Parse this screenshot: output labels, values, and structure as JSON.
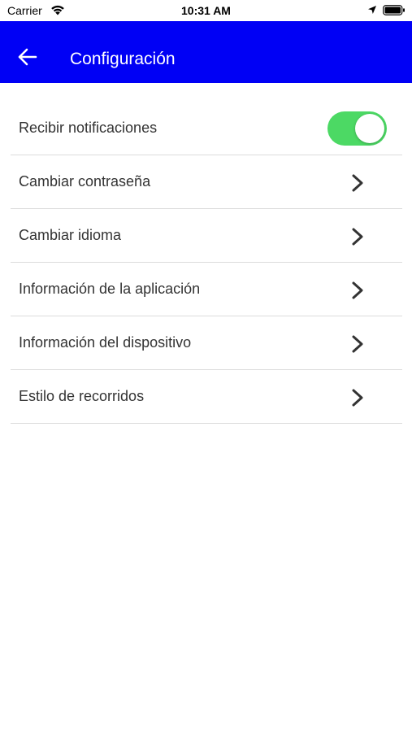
{
  "status_bar": {
    "carrier": "Carrier",
    "time": "10:31 AM",
    "wifi_icon": "wifi-icon",
    "location_icon": "location-arrow-icon",
    "battery_icon": "battery-full-icon"
  },
  "app_bar": {
    "title": "Configuración",
    "back_icon": "arrow-left-icon",
    "background_color": "#0000f5"
  },
  "settings": {
    "notifications": {
      "label": "Recibir notificaciones",
      "enabled": true,
      "toggle_color": "#4cd964"
    },
    "items": [
      {
        "label": "Cambiar contraseña",
        "icon": "chevron-right-icon"
      },
      {
        "label": "Cambiar idioma",
        "icon": "chevron-right-icon"
      },
      {
        "label": "Información de la aplicación",
        "icon": "chevron-right-icon"
      },
      {
        "label": "Información del dispositivo",
        "icon": "chevron-right-icon"
      },
      {
        "label": "Estilo de recorridos",
        "icon": "chevron-right-icon"
      }
    ]
  }
}
